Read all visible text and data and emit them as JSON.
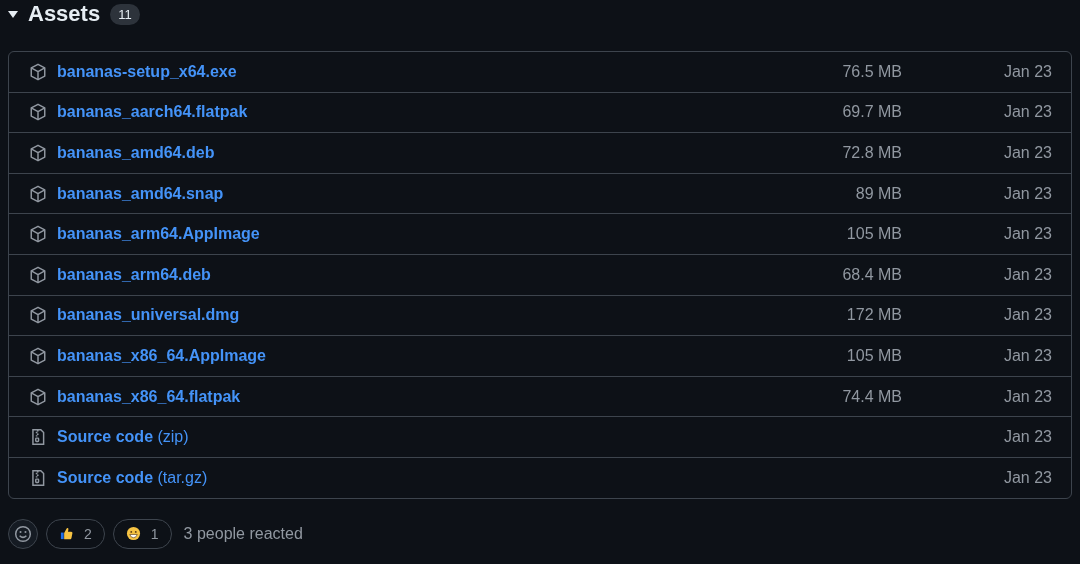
{
  "header": {
    "title": "Assets",
    "count": "11",
    "expanded": true
  },
  "assets": [
    {
      "kind": "package",
      "name": "bananas-setup_x64.exe",
      "size": "76.5 MB",
      "date": "Jan 23"
    },
    {
      "kind": "package",
      "name": "bananas_aarch64.flatpak",
      "size": "69.7 MB",
      "date": "Jan 23"
    },
    {
      "kind": "package",
      "name": "bananas_amd64.deb",
      "size": "72.8 MB",
      "date": "Jan 23"
    },
    {
      "kind": "package",
      "name": "bananas_amd64.snap",
      "size": "89 MB",
      "date": "Jan 23"
    },
    {
      "kind": "package",
      "name": "bananas_arm64.AppImage",
      "size": "105 MB",
      "date": "Jan 23"
    },
    {
      "kind": "package",
      "name": "bananas_arm64.deb",
      "size": "68.4 MB",
      "date": "Jan 23"
    },
    {
      "kind": "package",
      "name": "bananas_universal.dmg",
      "size": "172 MB",
      "date": "Jan 23"
    },
    {
      "kind": "package",
      "name": "bananas_x86_64.AppImage",
      "size": "105 MB",
      "date": "Jan 23"
    },
    {
      "kind": "package",
      "name": "bananas_x86_64.flatpak",
      "size": "74.4 MB",
      "date": "Jan 23"
    },
    {
      "kind": "source",
      "name": "Source code",
      "format": "(zip)",
      "date": "Jan 23"
    },
    {
      "kind": "source",
      "name": "Source code",
      "format": "(tar.gz)",
      "date": "Jan 23"
    }
  ],
  "reactions": [
    {
      "kind": "thumbs_up",
      "count": "2"
    },
    {
      "kind": "grin",
      "count": "1"
    }
  ],
  "reacted_text": "3 people reacted"
}
